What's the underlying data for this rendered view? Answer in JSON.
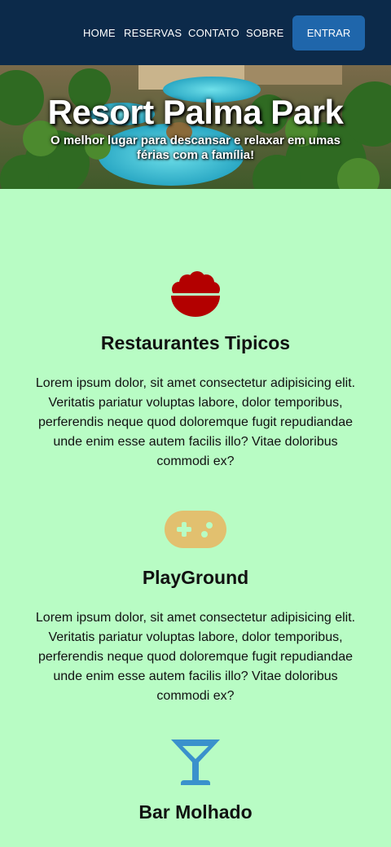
{
  "nav": {
    "links": [
      "HOME",
      "RESERVAS",
      "CONTATO",
      "SOBRE"
    ],
    "login_label": "ENTRAR",
    "bg_color": "#0c2a4a",
    "button_color": "#1f66ab"
  },
  "hero": {
    "title": "Resort Palma Park",
    "subtitle": "O melhor lugar para descansar e relaxar em umas férias com a família!"
  },
  "features": [
    {
      "icon": "food-bowl-icon",
      "icon_color": "#b30000",
      "title": "Restaurantes Tipicos",
      "text": "Lorem ipsum dolor, sit amet consectetur adipisicing elit. Veritatis pariatur voluptas labore, dolor temporibus, perferendis neque quod doloremque fugit repudiandae unde enim esse autem facilis illo? Vitae doloribus commodi ex?"
    },
    {
      "icon": "gamepad-icon",
      "icon_color": "#e2c06f",
      "title": "PlayGround",
      "text": "Lorem ipsum dolor, sit amet consectetur adipisicing elit. Veritatis pariatur voluptas labore, dolor temporibus, perferendis neque quod doloremque fugit repudiandae unde enim esse autem facilis illo? Vitae doloribus commodi ex?"
    },
    {
      "icon": "cocktail-icon",
      "icon_color": "#3a91cc",
      "title": "Bar Molhado"
    }
  ],
  "page_bg": "#b8fcc4"
}
